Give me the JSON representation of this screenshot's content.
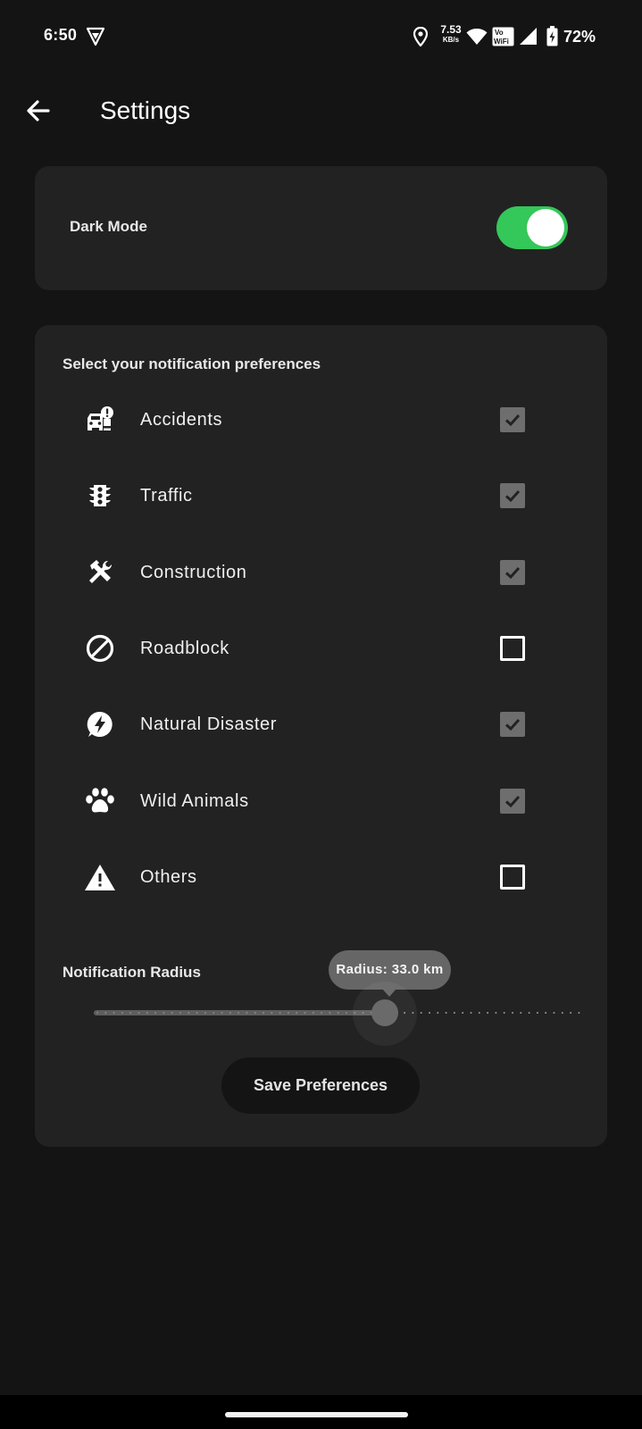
{
  "status_bar": {
    "time": "6:50",
    "net_speed_value": "7.53",
    "net_speed_unit": "KB/s",
    "vowifi_top": "Vo",
    "vowifi_bottom": "WiFi",
    "battery_percent": "72%",
    "icons": [
      "vpn-shield-icon",
      "location-icon",
      "wifi-icon",
      "vowifi-icon",
      "signal-icon",
      "battery-charging-icon"
    ]
  },
  "app_bar": {
    "title": "Settings",
    "back_icon": "arrow-left-icon"
  },
  "dark_mode": {
    "label": "Dark Mode",
    "enabled": true,
    "accent_color": "#34c759"
  },
  "preferences": {
    "heading": "Select your notification preferences",
    "items": [
      {
        "label": "Accidents",
        "icon": "car-crash-icon",
        "checked": true
      },
      {
        "label": "Traffic",
        "icon": "traffic-light-icon",
        "checked": true
      },
      {
        "label": "Construction",
        "icon": "construction-tools-icon",
        "checked": true
      },
      {
        "label": "Roadblock",
        "icon": "block-icon",
        "checked": false
      },
      {
        "label": "Natural Disaster",
        "icon": "flash-bolt-icon",
        "checked": true
      },
      {
        "label": "Wild Animals",
        "icon": "paw-icon",
        "checked": true
      },
      {
        "label": "Others",
        "icon": "warning-icon",
        "checked": false
      }
    ]
  },
  "radius": {
    "label": "Notification Radius",
    "tooltip": "Radius: 33.0 km",
    "value_km": 33.0,
    "fraction": 0.6
  },
  "save_button_label": "Save Preferences"
}
